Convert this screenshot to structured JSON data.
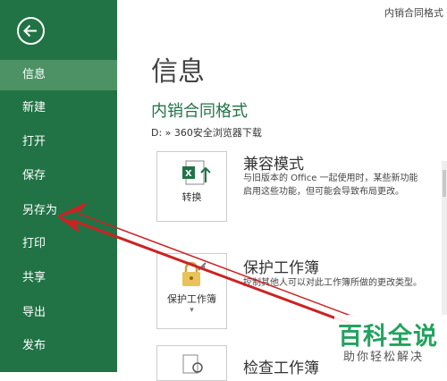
{
  "window": {
    "file_title": "内销合同格式"
  },
  "sidebar": {
    "items": [
      {
        "label": "信息"
      },
      {
        "label": "新建"
      },
      {
        "label": "打开"
      },
      {
        "label": "保存"
      },
      {
        "label": "另存为"
      },
      {
        "label": "打印"
      },
      {
        "label": "共享"
      },
      {
        "label": "导出"
      },
      {
        "label": "发布"
      }
    ],
    "active_index": 0,
    "color": "#217346"
  },
  "main": {
    "page_title": "信息",
    "doc_name": "内销合同格式",
    "doc_path": "D: » 360安全浏览器下载",
    "sections": [
      {
        "button_label": "转换",
        "icon": "excel-convert-icon",
        "title": "兼容模式",
        "desc": [
          "与旧版本的 Office 一起使用时，某些新功能",
          "启用这些功能，但可能会导致布局更改。"
        ]
      },
      {
        "button_label": "保护工作簿",
        "icon": "lock-key-icon",
        "title": "保护工作簿",
        "desc": [
          "控制其他人可以对此工作簿所做的更改类型。"
        ]
      },
      {
        "button_label": "",
        "icon": "inspect-icon",
        "title": "检查工作簿",
        "desc": []
      }
    ]
  },
  "watermark": {
    "main": "百科全说",
    "sub": "助你轻松解决"
  },
  "annotation": {
    "arrow_color": "#cc2222"
  }
}
